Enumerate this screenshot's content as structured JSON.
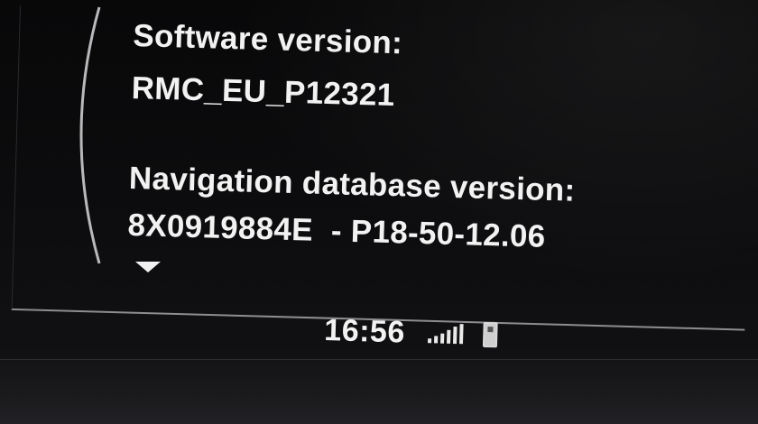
{
  "info": {
    "software_label": "Software version:",
    "software_value": "RMC_EU_P12321",
    "nav_db_label": "Navigation database version:",
    "nav_db_value": "8X0919884E  - P18-50-12.06"
  },
  "status": {
    "time": "16:56",
    "signal_icon": "signal-strength-icon",
    "phone_icon": "phone-icon"
  },
  "scroll": {
    "icon": "scroll-down-arrow-icon"
  },
  "colors": {
    "background": "#0b0b0c",
    "text": "#f2f2f2",
    "divider": "#8e8e92"
  }
}
